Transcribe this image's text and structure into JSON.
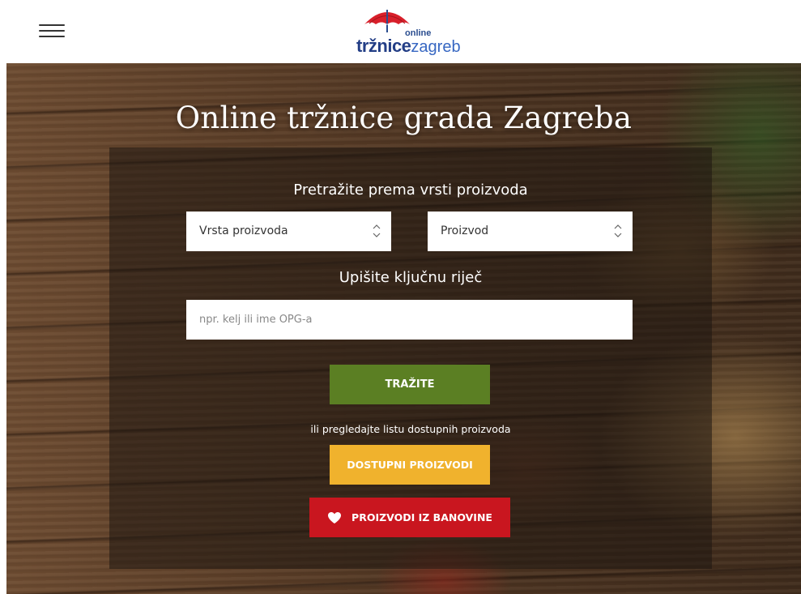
{
  "header": {
    "menu_icon": "hamburger-menu-icon",
    "logo": {
      "icon": "umbrella-icon",
      "online": "online",
      "brand_bold": "tržnice",
      "brand_light": "zagreb",
      "colors": {
        "umbrella": "#d81f2a",
        "brand": "#233e86",
        "brand_light": "#3767c2"
      }
    }
  },
  "hero": {
    "title": "Online tržnice grada Zagreba",
    "search": {
      "label_type": "Pretražite prema vrsti proizvoda",
      "select_category": "Vrsta proizvoda",
      "select_product": "Proizvod",
      "label_keyword": "Upišite ključnu riječ",
      "keyword_placeholder": "npr. kelj ili ime OPG-a",
      "keyword_value": ""
    },
    "search_button": "TRAŽITE",
    "or_text": "ili pregledajte listu dostupnih proizvoda",
    "available_button": "DOSTUPNI PROIZVODI",
    "banovina_button": "PROIZVODI IZ BANOVINE",
    "banovina_icon": "heart-icon",
    "colors": {
      "search_button": "#5b7f23",
      "available_button": "#f0b22d",
      "banovina_button": "#c9161f"
    }
  }
}
